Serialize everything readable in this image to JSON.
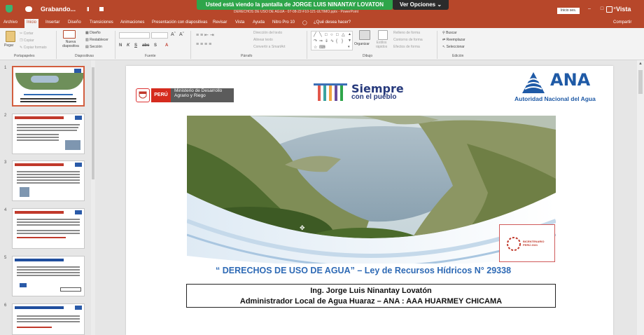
{
  "titlebar": {
    "recording_label": "Grabando...",
    "pause_glyph": "II",
    "document_title": "DERECHOS DE USO DE AGUA - 07-08-22-F10-121-ULTIMO.pptx  -  PowerPoint",
    "login_label": "Inicio ses.",
    "window_buttons": "– □ ×",
    "view_label": "Vista"
  },
  "share_banner": {
    "text": "Usted está viendo la pantalla de JORGE LUIS NINANTAY LOVATON",
    "options_label": "Ver Opciones"
  },
  "tabs": [
    {
      "label": "Archivo",
      "active": false
    },
    {
      "label": "Inicio",
      "active": true
    },
    {
      "label": "Insertar",
      "active": false
    },
    {
      "label": "Diseño",
      "active": false
    },
    {
      "label": "Transiciones",
      "active": false
    },
    {
      "label": "Animaciones",
      "active": false
    },
    {
      "label": "Presentación con diapositivas",
      "active": false
    },
    {
      "label": "Revisar",
      "active": false
    },
    {
      "label": "Vista",
      "active": false
    },
    {
      "label": "Ayuda",
      "active": false
    },
    {
      "label": "Nitro Pro 10",
      "active": false
    },
    {
      "label": "¿Qué desea hacer?",
      "active": false
    }
  ],
  "share_label": "Compartir",
  "ribbon": {
    "clipboard": {
      "paste": "Pegar",
      "cut": "Cortar",
      "copy": "Copiar",
      "format_painter": "Copiar formato",
      "group_label": "Portapapeles"
    },
    "slides": {
      "new_slide": "Nueva diapositiva",
      "layout": "Diseño",
      "reset": "Restablecer",
      "section": "Sección",
      "group_label": "Diapositivas"
    },
    "font": {
      "format_buttons": [
        "N",
        "K",
        "S",
        "abc",
        "S"
      ],
      "group_label": "Fuente"
    },
    "paragraph": {
      "text_direction": "Dirección del texto",
      "align_text": "Alinear texto",
      "smartart": "Convertir a SmartArt",
      "group_label": "Párrafo"
    },
    "drawing": {
      "arrange": "Organizar",
      "quick_styles": "Estilos rápidos",
      "shape_fill": "Relleno de forma",
      "shape_outline": "Contorno de forma",
      "shape_effects": "Efectos de forma",
      "group_label": "Dibujo"
    },
    "editing": {
      "find": "Buscar",
      "replace": "Reemplazar",
      "select": "Seleccionar",
      "group_label": "Edición"
    }
  },
  "thumbnails": [
    {
      "number": "1",
      "selected": true
    },
    {
      "number": "2",
      "selected": false
    },
    {
      "number": "3",
      "selected": false
    },
    {
      "number": "4",
      "selected": false
    },
    {
      "number": "5",
      "selected": false
    },
    {
      "number": "6",
      "selected": false
    }
  ],
  "slide": {
    "peru_label": "PERÚ",
    "ministry_label": "Ministerio de Desarrollo Agrario y Riego",
    "campaign_title": "Siempre",
    "campaign_sub": "con el pueblo",
    "ana_acronym": "ANA",
    "ana_full": "Autoridad Nacional del Agua",
    "bicentenario_label": "BICENTENARIO PERÚ 2021",
    "main_title": "“ DERECHOS DE USO DE AGUA” – Ley de Recursos Hídricos N° 29338",
    "presenter_name": "Ing.  Jorge Luis Ninantay Lovatón",
    "presenter_role": "Administrador Local de Agua Huaraz – ANA : AAA HUARMEY CHICAMA"
  },
  "colors": {
    "ppt_red": "#b7472a",
    "share_green": "#2ea54a",
    "ana_blue": "#1f5aa6",
    "title_blue": "#2e6ab5"
  }
}
